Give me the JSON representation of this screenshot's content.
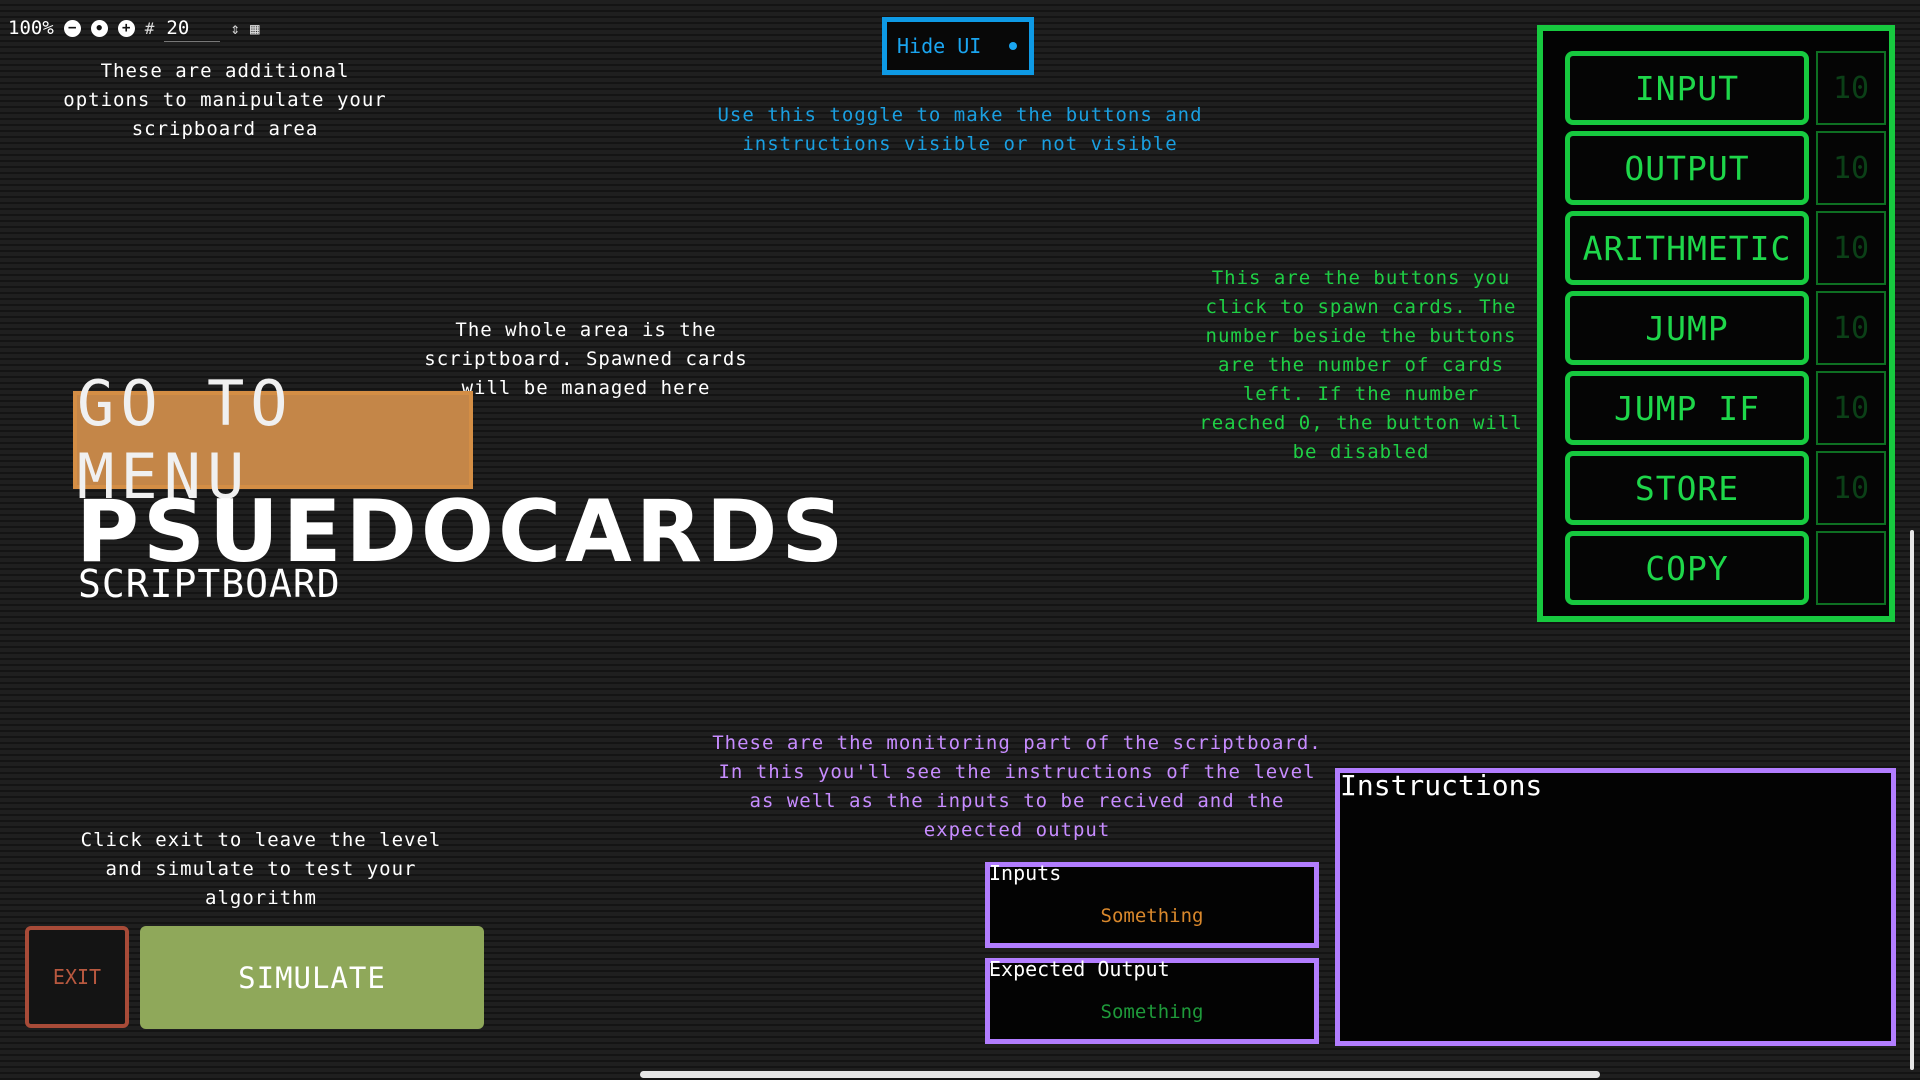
{
  "toolbar": {
    "zoom": "100%",
    "minus_icon": "−",
    "reset_icon": "●",
    "plus_icon": "+",
    "grid_icon": "#",
    "grid_size": "20",
    "stepper_icon": "⇕",
    "map_icon": "▦"
  },
  "notes": {
    "options": "These are additional options to manipulate your scripboard area",
    "toggle": "Use this toggle to make the buttons and instructions visible or not visible",
    "scriptboard": "The whole area is the scriptboard. Spawned cards will be managed here",
    "spawn": "This are the buttons you click to spawn cards. The number beside the buttons are the number of cards left. If the number reached 0, the button will be disabled",
    "monitoring": "These are the monitoring part of the scriptboard. In this you'll see the instructions of the level as well as the inputs to be recived and the expected output",
    "exit_sim": "Click exit to leave the level and simulate to test your algorithm"
  },
  "hide_ui": {
    "label": "Hide UI"
  },
  "spawn_buttons": [
    {
      "label": "INPUT",
      "count": "10"
    },
    {
      "label": "OUTPUT",
      "count": "10"
    },
    {
      "label": "ARITHMETIC",
      "count": "10"
    },
    {
      "label": "JUMP",
      "count": "10"
    },
    {
      "label": "JUMP IF",
      "count": "10"
    },
    {
      "label": "STORE",
      "count": "10"
    },
    {
      "label": "COPY",
      "count": ""
    }
  ],
  "menu": {
    "label": "GO TO MENU"
  },
  "logo": {
    "title": "PSUEDOCARDS",
    "subtitle": "SCRIPTBOARD"
  },
  "actions": {
    "exit": "EXIT",
    "simulate": "SIMULATE"
  },
  "monitor": {
    "inputs_label": "Inputs",
    "inputs_value": "Something",
    "expected_label": "Expected Output",
    "expected_value": "Something",
    "instructions_label": "Instructions"
  },
  "colors": {
    "spawn_green": "#17c93f",
    "toggle_blue": "#0e9ae5",
    "monitor_purple": "#b27dff",
    "menu_brown": "#c48648",
    "simulate_green": "#8fa85a",
    "exit_red": "#a84b38",
    "inputs_value": "#d9882c",
    "expected_value": "#1e9a3a"
  }
}
